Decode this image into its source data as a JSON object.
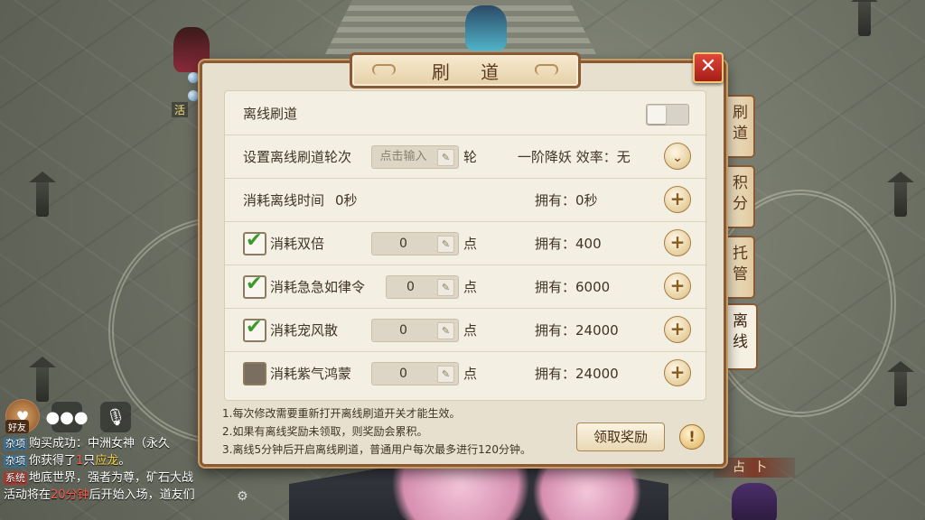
{
  "dialog": {
    "title": "刷 道",
    "close_label": "✕",
    "rows": {
      "offline_toggle": {
        "label": "离线刷道",
        "enabled": false
      },
      "rounds": {
        "label": "设置离线刷道轮次",
        "input_placeholder": "点击输入",
        "unit": "轮",
        "efficiency": "一阶降妖 效率：无"
      },
      "time": {
        "label": "消耗离线时间",
        "value": "0秒",
        "own": "拥有：0秒"
      },
      "items": [
        {
          "label": "消耗双倍",
          "checked": true,
          "value": "0",
          "unit": "点",
          "own": "拥有：400"
        },
        {
          "label": "消耗急急如律令",
          "checked": true,
          "value": "0",
          "unit": "点",
          "own": "拥有：6000"
        },
        {
          "label": "消耗宠风散",
          "checked": true,
          "value": "0",
          "unit": "点",
          "own": "拥有：24000"
        },
        {
          "label": "消耗紫气鸿蒙",
          "checked": false,
          "value": "0",
          "unit": "点",
          "own": "拥有：24000"
        }
      ]
    },
    "notes": [
      "1.每次修改需要重新打开离线刷道开关才能生效。",
      "2.如果有离线奖励未领取，则奖励会累积。",
      "3.离线5分钟后开启离线刷道，普通用户每次最多进行120分钟。"
    ],
    "claim_button": "领取奖励",
    "info_button": "!"
  },
  "side_tabs": [
    {
      "label": "刷道",
      "active": false
    },
    {
      "label": "积分",
      "active": false
    },
    {
      "label": "托管",
      "active": false
    },
    {
      "label": "离线",
      "active": true
    }
  ],
  "hud": {
    "side_tag": "活",
    "friend_label": "好友",
    "divination": "占卜"
  },
  "chat": [
    {
      "tag": "杂项",
      "text": "购买成功：中洲女神（永久"
    },
    {
      "tag": "杂项",
      "text_a": "你获得了",
      "num": "1",
      "text_b": "只",
      "item": "应龙",
      "text_c": "。"
    },
    {
      "tag": "系统",
      "text": "地底世界，强者为尊，矿石大战"
    },
    {
      "text_a": "活动将在",
      "time": "20分钟",
      "text_b": "后开始入场，道友们"
    }
  ],
  "icons": {
    "close": "close-icon",
    "pencil": "pencil-icon",
    "plus": "plus-icon",
    "chevron": "chevron-down-icon",
    "info": "info-icon",
    "chat": "chat-icon",
    "mic": "microphone-icon",
    "friend": "friend-icon",
    "gear": "gear-icon"
  }
}
